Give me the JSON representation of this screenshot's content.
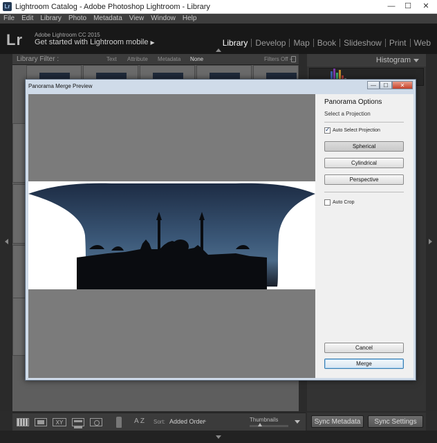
{
  "window": {
    "title": "Lightroom Catalog - Adobe Photoshop Lightroom - Library",
    "app_icon": "lr-app-icon",
    "minimize": "—",
    "maximize": "☐",
    "close": "✕"
  },
  "menubar": [
    "File",
    "Edit",
    "Library",
    "Photo",
    "Metadata",
    "View",
    "Window",
    "Help"
  ],
  "lr_header": {
    "logo": "Lr",
    "version": "Adobe Lightroom CC 2015",
    "mobile": "Get started with Lightroom mobile",
    "mobile_arrow": "▶",
    "modules": [
      "Library",
      "Develop",
      "Map",
      "Book",
      "Slideshow",
      "Print",
      "Web"
    ],
    "active_module": "Library"
  },
  "library_filter": {
    "label": "Library Filter :",
    "options": [
      "Text",
      "Attribute",
      "Metadata",
      "None"
    ],
    "active": "None",
    "filters_off": "Filters Off ÷"
  },
  "right_panel": {
    "histogram_title": "Histogram"
  },
  "toolbar": {
    "compare_label": "XY",
    "sort_icon": "A Z",
    "sort_label": "Sort:",
    "sort_value": "Added Order",
    "sort_arrow": "÷",
    "thumbnails_label": "Thumbnails"
  },
  "sync": {
    "metadata": "Sync Metadata",
    "settings": "Sync Settings"
  },
  "dialog": {
    "title": "Panorama Merge Preview",
    "minimize": "—",
    "maximize": "☐",
    "close": "✕",
    "options_title": "Panorama Options",
    "projection_label": "Select a Projection",
    "auto_select_label": "Auto Select Projection",
    "auto_select_checked": true,
    "projections": [
      "Spherical",
      "Cylindrical",
      "Perspective"
    ],
    "active_projection": "Spherical",
    "auto_crop_label": "Auto Crop",
    "auto_crop_checked": false,
    "cancel": "Cancel",
    "merge": "Merge"
  },
  "colors": {
    "lr_bg": "#181818",
    "dialog_frame": "#cfdbe9",
    "sky_top": "#1d2c44",
    "sky_bottom": "#4b6a88",
    "accent_button": "#3c7fb1"
  }
}
